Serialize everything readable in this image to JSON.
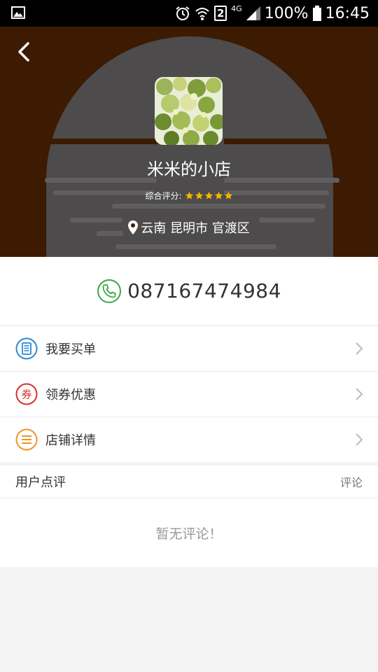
{
  "status_bar": {
    "gallery_icon": "image-icon",
    "alarm_icon": "alarm-icon",
    "wifi_icon": "wifi-icon",
    "sim_label": "2",
    "network_label": "4G",
    "signal_icon": "signal-icon",
    "battery_percent": "100%",
    "battery_icon": "battery-icon",
    "time": "16:45"
  },
  "header": {
    "back_icon": "chevron-left-icon",
    "shop_name": "米米的小店",
    "rating_label": "综合评分:",
    "rating_value": 5,
    "rating_max": 5,
    "location_icon": "map-pin-icon",
    "location": "云南 昆明市 官渡区",
    "bg_color": "#3d1a02"
  },
  "phone": {
    "icon": "phone-icon",
    "number": "087167474984",
    "icon_color": "#3aa647"
  },
  "menu": [
    {
      "label": "我要买单",
      "icon": "bill-icon",
      "color": "#2b8ad4"
    },
    {
      "label": "领券优惠",
      "icon": "coupon-icon",
      "color": "#d9302b",
      "icon_text": "券"
    },
    {
      "label": "店铺详情",
      "icon": "list-icon",
      "color": "#f0932a"
    }
  ],
  "reviews": {
    "title": "用户点评",
    "link": "评论",
    "empty_text": "暂无评论！"
  }
}
